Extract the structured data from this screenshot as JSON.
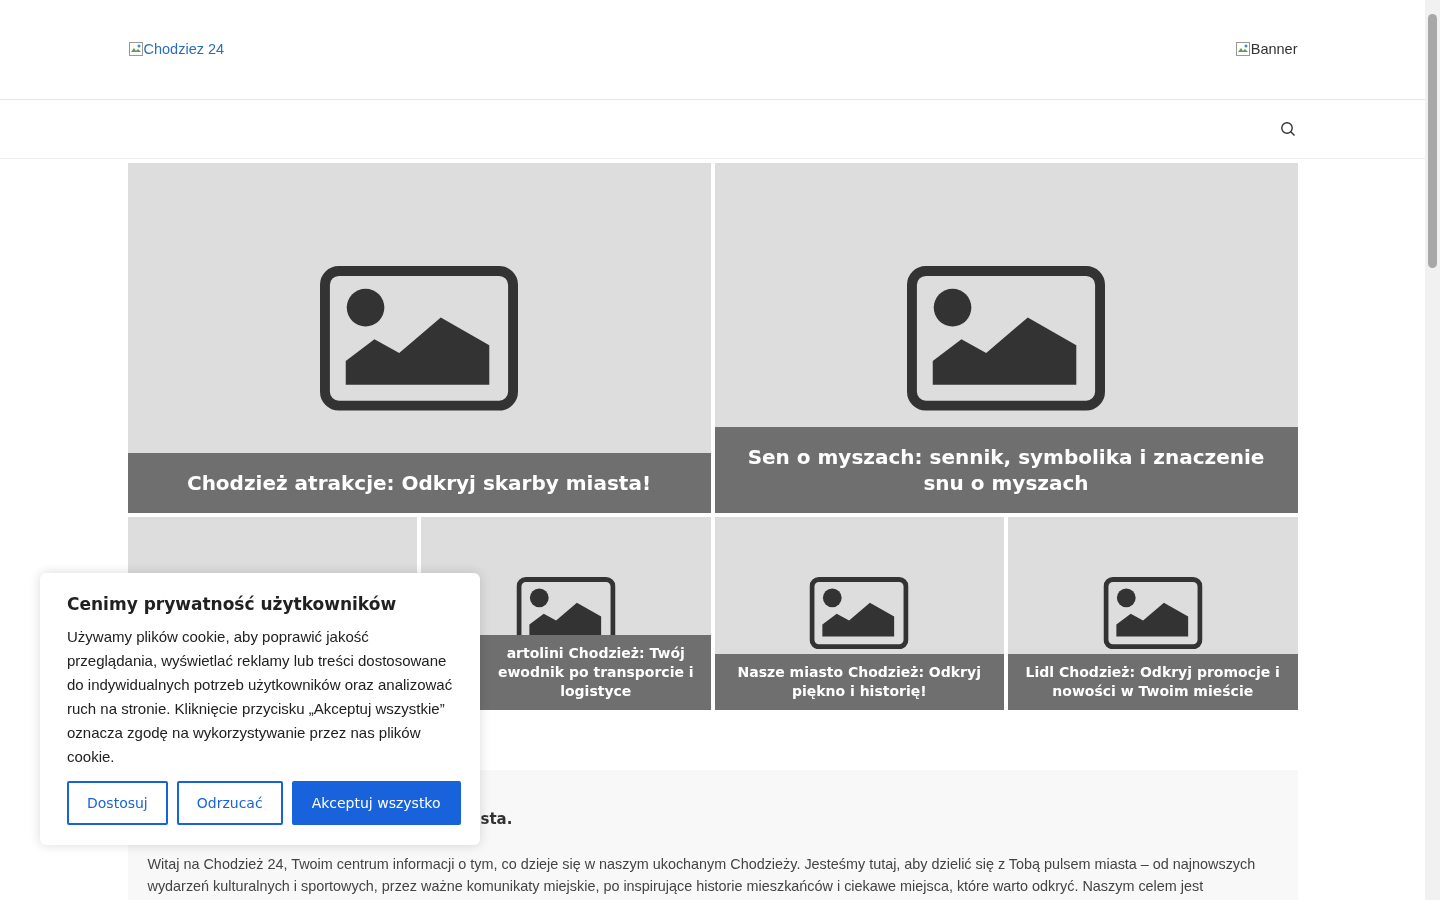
{
  "header": {
    "logo_alt": "Chodziez 24",
    "banner_alt": "Banner"
  },
  "featured": [
    {
      "title": "Chodzież atrakcje: Odkryj skarby miasta!"
    },
    {
      "title": "Sen o myszach: sennik, symbolika i znaczenie snu o myszach"
    }
  ],
  "posts": [
    {
      "kind": "picture"
    },
    {
      "kind": "clipped",
      "title": "artolini Chodzież: Twój\newodnik po transporcie i\nlogistyce"
    },
    {
      "kind": "post",
      "title": "Nasze miasto Chodzież: Odkryj piękno i historię!"
    },
    {
      "kind": "post",
      "title": "Lidl Chodzież: Odkryj promocje i nowości w Twoim mieście"
    }
  ],
  "intro": {
    "heading": "sta.",
    "text": "Witaj na Chodzież 24, Twoim centrum informacji o tym, co dzieje się w naszym ukochanym Chodzieży. Jesteśmy tutaj, aby dzielić się z Tobą pulsem miasta – od najnowszych\nwydarzeń kulturalnych i sportowych, przez ważne komunikaty miejskie, po inspirujące historie mieszkańców i ciekawe miejsca, które warto odkryć. Naszym celem jest"
  },
  "cookie_notice": {
    "title": "Cenimy prywatność użytkowników",
    "text": "Używamy plików cookie, aby poprawić jakość przeglądania, wyświetlać reklamy lub treści dostosowane do indywidualnych potrzeb użytkowników oraz analizować ruch na stronie. Kliknięcie przycisku „Akceptuj wszystkie” oznacza zgodę na wykorzystywanie przez nas plików cookie.",
    "buttons": [
      {
        "label": "Dostosuj",
        "kind": "outline"
      },
      {
        "label": "Odrzucać",
        "kind": "outline"
      },
      {
        "label": "Akceptuj wszystko",
        "kind": "primary"
      }
    ]
  }
}
